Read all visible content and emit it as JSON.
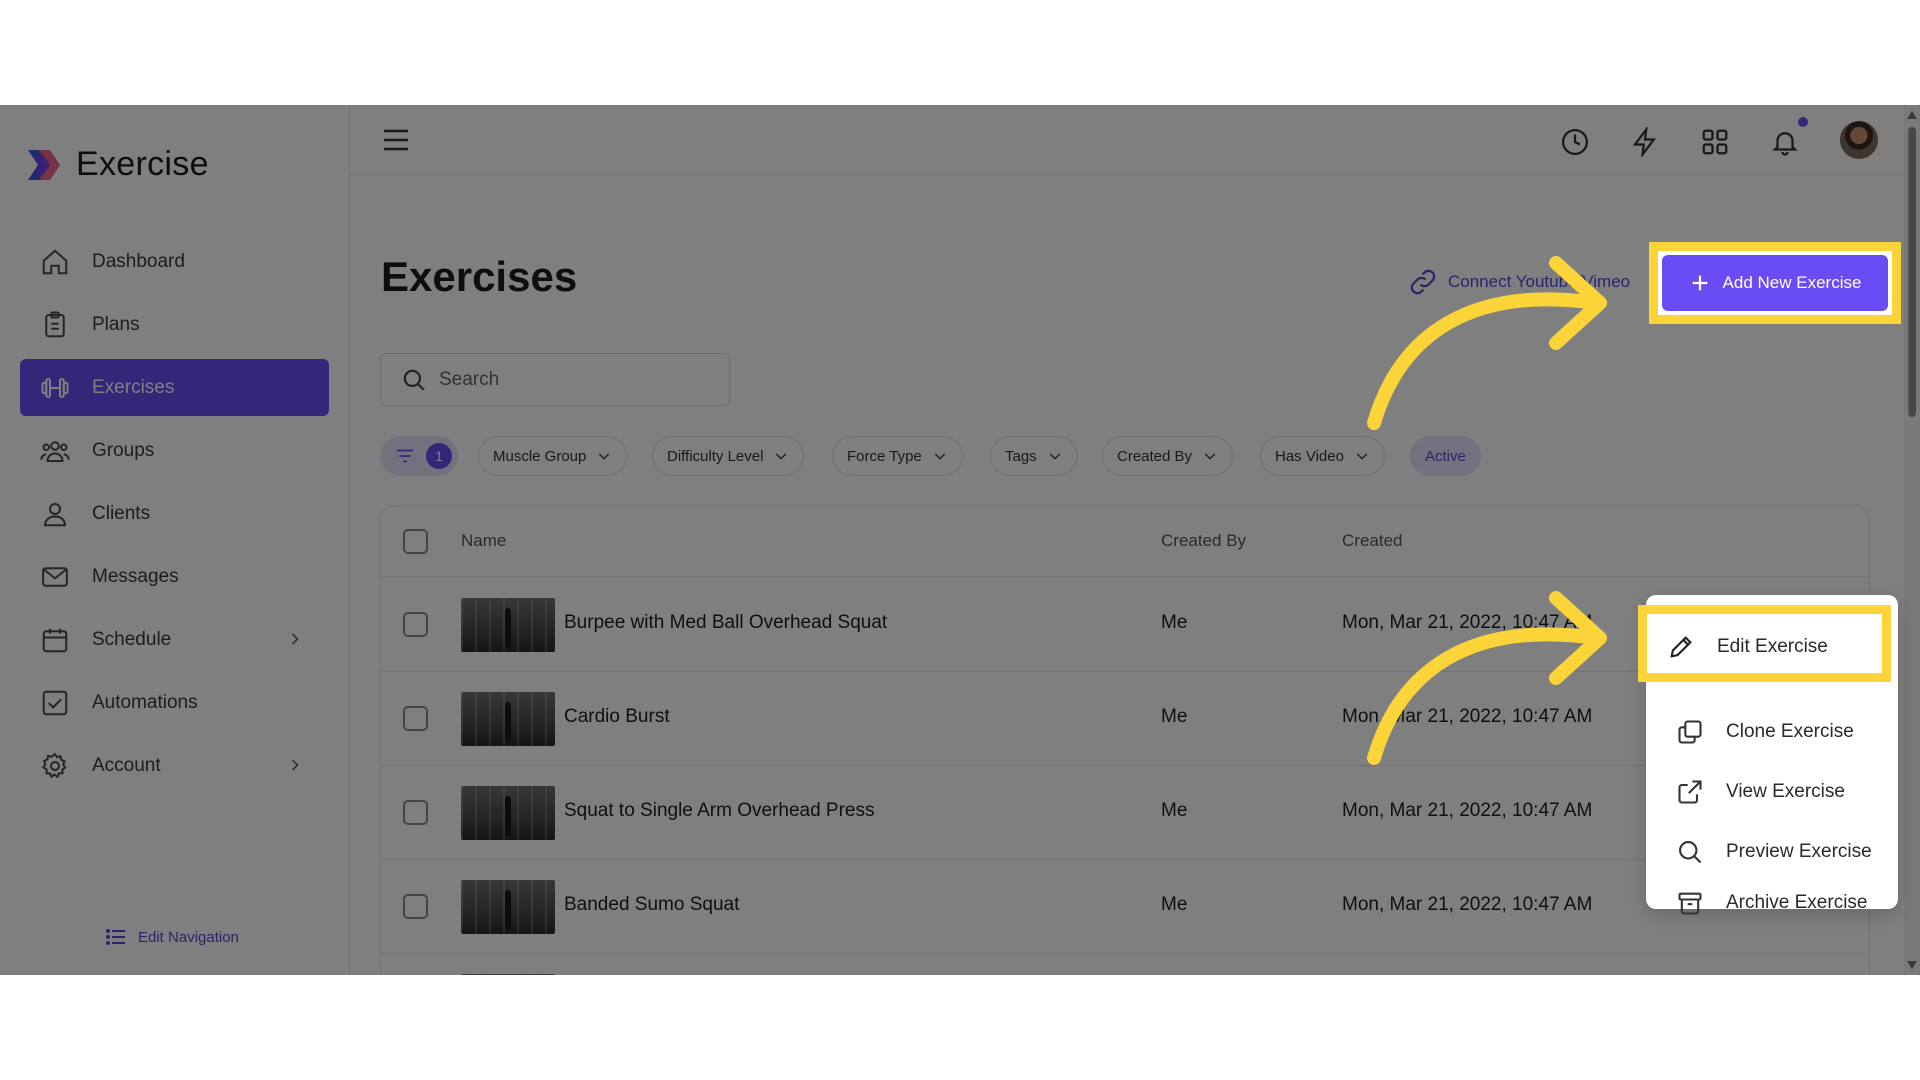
{
  "app": {
    "name": "Exercise"
  },
  "sidebar": {
    "items": [
      {
        "label": "Dashboard",
        "icon": "home-icon"
      },
      {
        "label": "Plans",
        "icon": "clipboard-icon"
      },
      {
        "label": "Exercises",
        "icon": "dumbbell-icon",
        "active": true
      },
      {
        "label": "Groups",
        "icon": "users-icon"
      },
      {
        "label": "Clients",
        "icon": "user-icon"
      },
      {
        "label": "Messages",
        "icon": "mail-icon"
      },
      {
        "label": "Schedule",
        "icon": "calendar-icon",
        "has_submenu": true
      },
      {
        "label": "Automations",
        "icon": "checkbox-icon"
      },
      {
        "label": "Account",
        "icon": "gear-icon",
        "has_submenu": true
      }
    ],
    "edit_navigation": "Edit Navigation"
  },
  "topbar": {
    "icons": [
      "menu-icon",
      "clock-icon",
      "lightning-icon",
      "grid-icon",
      "bell-icon",
      "avatar"
    ]
  },
  "page": {
    "title": "Exercises",
    "connect_link": "Connect Youtube/Vimeo",
    "add_button": "Add New Exercise",
    "search_placeholder": "Search",
    "filter_count": "1",
    "filters": [
      "Muscle Group",
      "Difficulty Level",
      "Force Type",
      "Tags",
      "Created By",
      "Has Video"
    ],
    "status_chip": "Active"
  },
  "table": {
    "columns": [
      "Name",
      "Created By",
      "Created"
    ],
    "rows": [
      {
        "name": "Burpee with Med Ball Overhead Squat",
        "created_by": "Me",
        "created": "Mon, Mar 21, 2022, 10:47 AM"
      },
      {
        "name": "Cardio Burst",
        "created_by": "Me",
        "created": "Mon, Mar 21, 2022, 10:47 AM"
      },
      {
        "name": "Squat to Single Arm Overhead Press",
        "created_by": "Me",
        "created": "Mon, Mar 21, 2022, 10:47 AM"
      },
      {
        "name": "Banded Sumo Squat",
        "created_by": "Me",
        "created": "Mon, Mar 21, 2022, 10:47 AM"
      }
    ]
  },
  "row_menu": {
    "items": [
      "Edit Exercise",
      "Clone Exercise",
      "View Exercise",
      "Preview Exercise",
      "Archive Exercise"
    ]
  },
  "colors": {
    "accent": "#6a4cf5",
    "highlight": "#fbd43a",
    "overlay": "rgba(0,0,0,0.5)"
  }
}
